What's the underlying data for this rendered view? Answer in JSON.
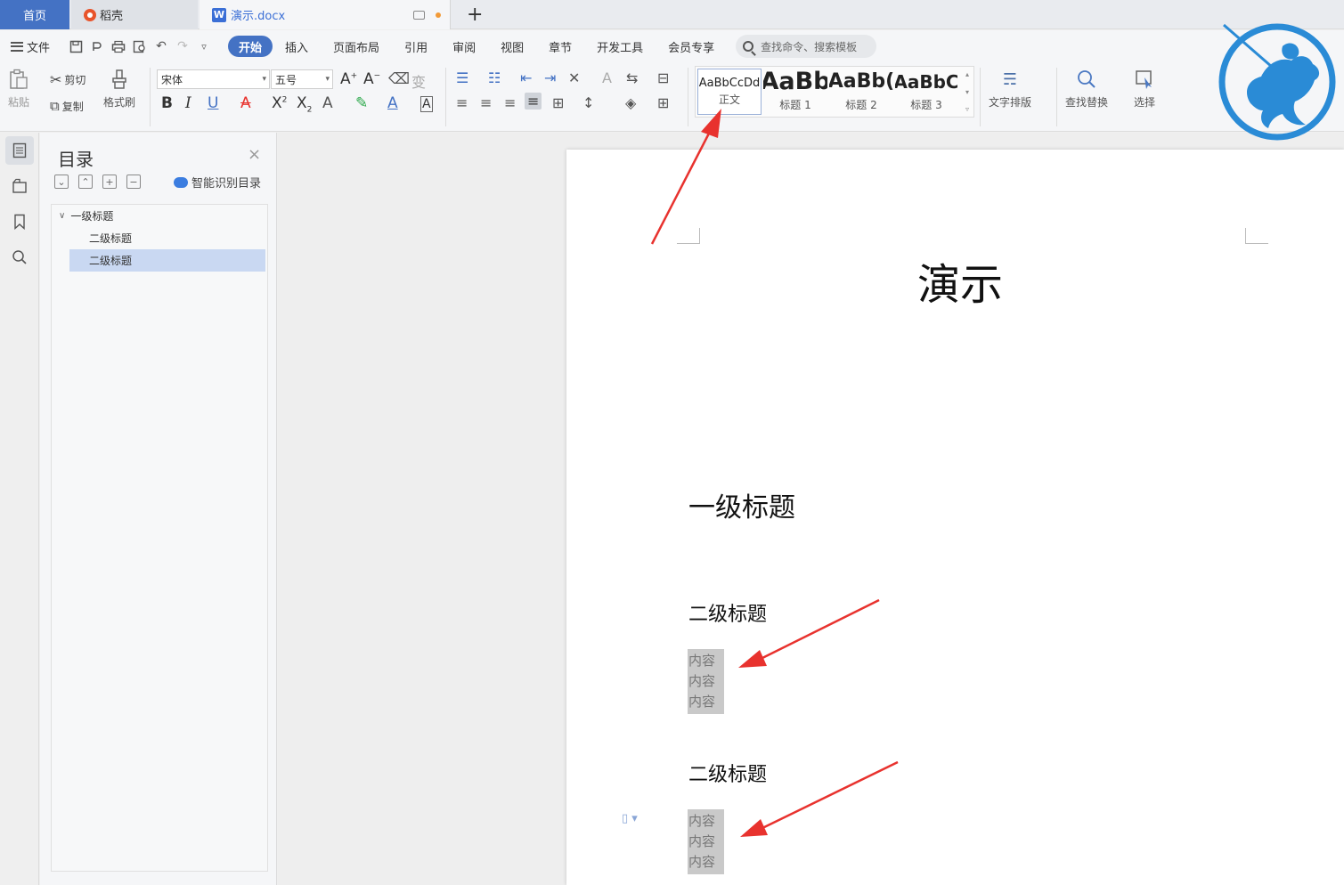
{
  "tabs": {
    "home": "首页",
    "daoke": "稻壳",
    "doc": "演示.docx",
    "add": "+"
  },
  "menu": {
    "file": "文件",
    "items": [
      "开始",
      "插入",
      "页面布局",
      "引用",
      "审阅",
      "视图",
      "章节",
      "开发工具",
      "会员专享"
    ],
    "search_placeholder": "查找命令、搜索模板"
  },
  "ribbon": {
    "paste": "粘贴",
    "cut": "剪切",
    "copy": "复制",
    "format_painter": "格式刷",
    "font_name": "宋体",
    "font_size": "五号",
    "styles": [
      {
        "sample": "AaBbCcDd",
        "name": "正文"
      },
      {
        "sample": "AaBb",
        "name": "标题 1"
      },
      {
        "sample": "AaBb(",
        "name": "标题 2"
      },
      {
        "sample": "AaBbC",
        "name": "标题 3"
      }
    ],
    "text_layout": "文字排版",
    "find_replace": "查找替换",
    "select": "选择"
  },
  "toc": {
    "title": "目录",
    "smart": "智能识别目录",
    "items": [
      "一级标题",
      "二级标题",
      "二级标题"
    ]
  },
  "document": {
    "title": "演示",
    "h1": "一级标题",
    "sections": [
      {
        "heading": "二级标题",
        "lines": [
          "内容",
          "内容",
          "内容"
        ]
      },
      {
        "heading": "二级标题",
        "lines": [
          "内容",
          "内容",
          "内容"
        ]
      }
    ]
  },
  "colors": {
    "accent": "#4472c4",
    "annotation_arrow": "#e8322e",
    "logo": "#2a8bd6"
  }
}
